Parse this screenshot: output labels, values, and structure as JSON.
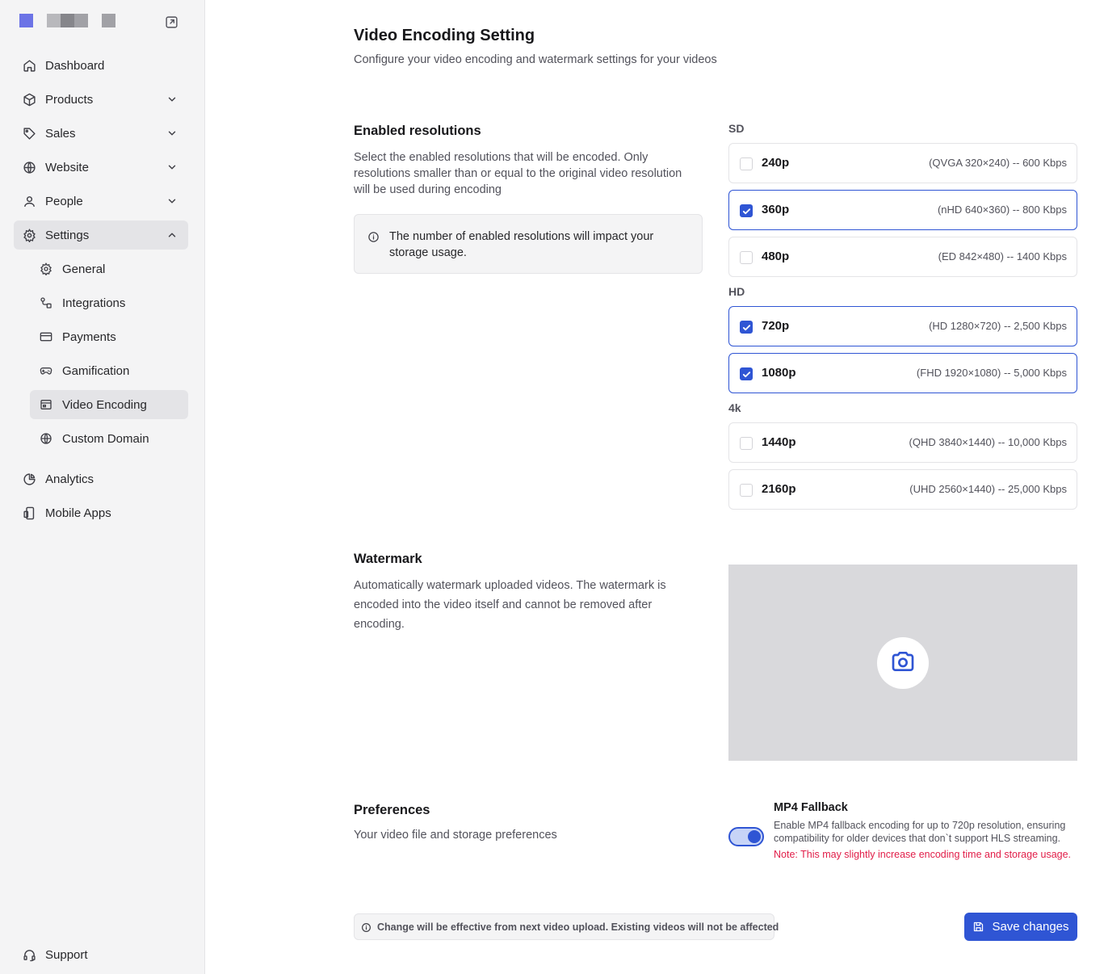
{
  "colors": {
    "accent": "#2f55d4",
    "sidebar_bg": "#f4f4f5",
    "danger": "#e11d48"
  },
  "sidebar": {
    "items": [
      {
        "label": "Dashboard",
        "icon": "home-icon"
      },
      {
        "label": "Products",
        "icon": "box-icon"
      },
      {
        "label": "Sales",
        "icon": "tag-icon"
      },
      {
        "label": "Website",
        "icon": "globe-icon"
      },
      {
        "label": "People",
        "icon": "user-icon"
      },
      {
        "label": "Settings",
        "icon": "gear-icon"
      }
    ],
    "settings_sub": [
      {
        "label": "General",
        "icon": "gear-icon"
      },
      {
        "label": "Integrations",
        "icon": "integrations-icon"
      },
      {
        "label": "Payments",
        "icon": "credit-card-icon"
      },
      {
        "label": "Gamification",
        "icon": "gamepad-icon"
      },
      {
        "label": "Video Encoding",
        "icon": "video-encoding-icon"
      },
      {
        "label": "Custom Domain",
        "icon": "globe-icon"
      }
    ],
    "bottom_items": [
      {
        "label": "Analytics",
        "icon": "pie-chart-icon"
      },
      {
        "label": "Mobile Apps",
        "icon": "mobile-icon"
      }
    ],
    "support": {
      "label": "Support",
      "icon": "headset-icon"
    }
  },
  "header": {
    "title": "Video Encoding Setting",
    "subtitle": "Configure your video encoding and watermark settings for your videos"
  },
  "resolutions_section": {
    "title": "Enabled resolutions",
    "description": "Select the enabled resolutions that will be encoded. Only resolutions smaller than or equal to the original video resolution will be used during encoding",
    "info": "The number of enabled resolutions will impact your storage usage.",
    "groups": [
      {
        "label": "SD",
        "items": [
          {
            "name": "240p",
            "spec": "(QVGA 320×240) -- 600 Kbps",
            "checked": false
          },
          {
            "name": "360p",
            "spec": "(nHD 640×360) -- 800 Kbps",
            "checked": true
          },
          {
            "name": "480p",
            "spec": "(ED 842×480) -- 1400 Kbps",
            "checked": false
          }
        ]
      },
      {
        "label": "HD",
        "items": [
          {
            "name": "720p",
            "spec": "(HD 1280×720) -- 2,500 Kbps",
            "checked": true
          },
          {
            "name": "1080p",
            "spec": "(FHD 1920×1080) -- 5,000 Kbps",
            "checked": true
          }
        ]
      },
      {
        "label": "4k",
        "items": [
          {
            "name": "1440p",
            "spec": "(QHD 3840×1440) -- 10,000 Kbps",
            "checked": false
          },
          {
            "name": "2160p",
            "spec": "(UHD 2560×1440) -- 25,000 Kbps",
            "checked": false
          }
        ]
      }
    ]
  },
  "watermark_section": {
    "title": "Watermark",
    "description": "Automatically watermark uploaded videos. The watermark is encoded into the video itself and cannot be removed after encoding.",
    "upload_icon": "camera-icon"
  },
  "preferences_section": {
    "title": "Preferences",
    "description": "Your video file and storage preferences",
    "mp4_fallback": {
      "title": "MP4 Fallback",
      "enabled": true,
      "description": "Enable MP4 fallback encoding for up to 720p resolution, ensuring compatibility for older devices that don`t support HLS streaming.",
      "note": "Note: This may slightly increase encoding time and storage usage."
    }
  },
  "footer": {
    "notice": "Change will be effective from next video upload. Existing videos will not be affected",
    "save_label": "Save changes"
  }
}
